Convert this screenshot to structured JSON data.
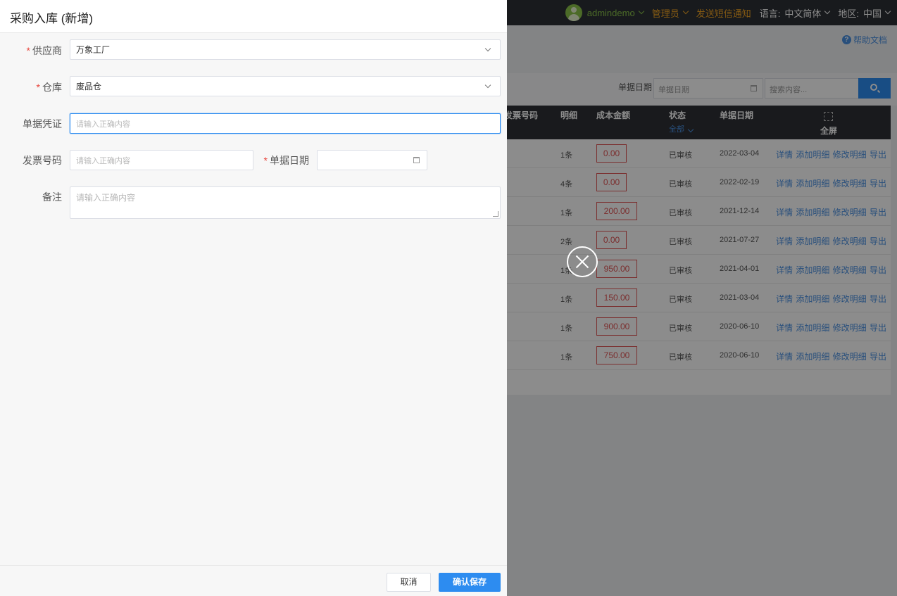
{
  "topbar": {
    "user": "admindemo",
    "role": "管理员",
    "sms": "发送短信通知",
    "language_label": "语言:",
    "language_value": "中文简体",
    "region_label": "地区:",
    "region_value": "中国"
  },
  "help_link": "帮助文档",
  "help_icon_glyph": "?",
  "filters": {
    "date_label": "单据日期",
    "date_placeholder": "单据日期",
    "search_placeholder": "搜索内容..."
  },
  "table": {
    "headers": {
      "invoice": "发票号码",
      "detail": "明细",
      "cost": "成本金额",
      "status": "状态",
      "status_filter": "全部",
      "date": "单据日期",
      "fullscreen": "全屏"
    },
    "rows": [
      {
        "detail": "1条",
        "amount": "0.00",
        "status": "已审核",
        "date": "2022-03-04"
      },
      {
        "detail": "4条",
        "amount": "0.00",
        "status": "已审核",
        "date": "2022-02-19"
      },
      {
        "detail": "1条",
        "amount": "200.00",
        "status": "已审核",
        "date": "2021-12-14"
      },
      {
        "detail": "2条",
        "amount": "0.00",
        "status": "已审核",
        "date": "2021-07-27"
      },
      {
        "detail": "1条",
        "amount": "950.00",
        "status": "已审核",
        "date": "2021-04-01"
      },
      {
        "detail": "1条",
        "amount": "150.00",
        "status": "已审核",
        "date": "2021-03-04"
      },
      {
        "detail": "1条",
        "amount": "900.00",
        "status": "已审核",
        "date": "2020-06-10"
      },
      {
        "detail": "1条",
        "amount": "750.00",
        "status": "已审核",
        "date": "2020-06-10"
      }
    ],
    "row_actions": "详情 添加明细 修改明细 导出"
  },
  "drawer": {
    "title": "采购入库 (新增)",
    "required_mark": "*",
    "supplier": {
      "label": "供应商",
      "value": "万象工厂"
    },
    "warehouse": {
      "label": "仓库",
      "value": "废品仓"
    },
    "voucher": {
      "label": "单据凭证",
      "placeholder": "请输入正确内容"
    },
    "invoice": {
      "label": "发票号码",
      "placeholder": "请输入正确内容"
    },
    "doc_date": {
      "label": "单据日期",
      "value": ""
    },
    "remark": {
      "label": "备注",
      "placeholder": "请输入正确内容"
    },
    "cancel_label": "取消",
    "save_label": "确认保存"
  },
  "colors": {
    "accent": "#2d8cf0",
    "required": "#e8453c",
    "amount_border": "#e05555",
    "topbar_user": "#8bc34a",
    "topbar_role": "#f5a623"
  }
}
